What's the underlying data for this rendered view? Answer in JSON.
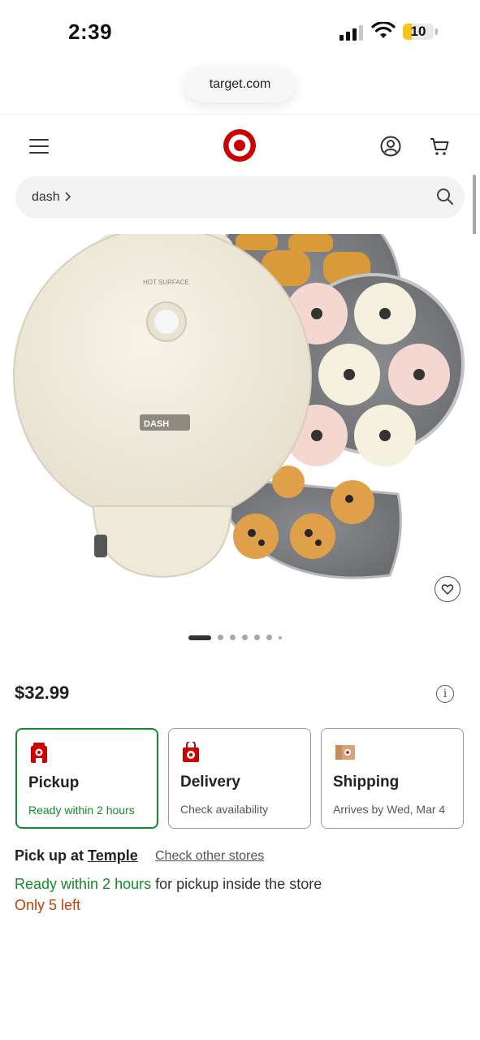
{
  "status_bar": {
    "time": "2:39",
    "battery": "10"
  },
  "browser": {
    "url": "target.com"
  },
  "header": {
    "search": {
      "value": "dash"
    }
  },
  "product": {
    "price": "$32.99",
    "gallery": {
      "image_count": 7,
      "active_index": 0
    },
    "image_text": {
      "warning": "HOT SURFACE",
      "brand": "DASH"
    }
  },
  "fulfillment": {
    "options": [
      {
        "title": "Pickup",
        "subtitle": "Ready within 2 hours",
        "selected": true
      },
      {
        "title": "Delivery",
        "subtitle": "Check availability",
        "selected": false
      },
      {
        "title": "Shipping",
        "subtitle": "Arrives by Wed, Mar 4",
        "selected": false
      }
    ],
    "pickup_label": "Pick up at",
    "store_name": "Temple",
    "check_other_stores": "Check other stores",
    "ready_green": "Ready within 2 hours",
    "ready_rest": " for pickup inside the store",
    "stock": "Only 5 left"
  },
  "colors": {
    "brand_red": "#cc0000",
    "success_green": "#148a2a",
    "warning_orange": "#c2400a"
  }
}
